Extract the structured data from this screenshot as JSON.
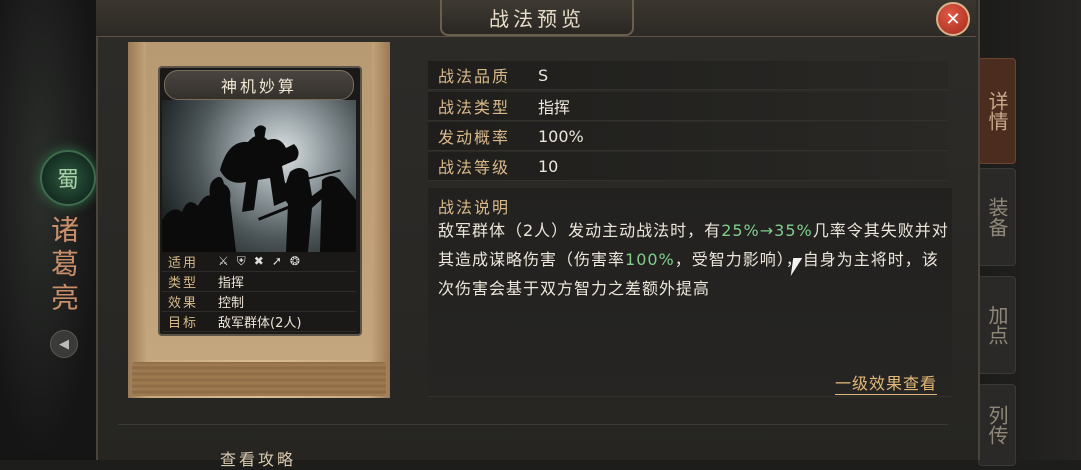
{
  "window": {
    "title": "战法预览",
    "close_label": "✕"
  },
  "hero": {
    "emblem_char": "蜀",
    "name": "诸葛亮"
  },
  "side_tabs": [
    {
      "label": "详情",
      "active": true
    },
    {
      "label": "装备",
      "active": false
    },
    {
      "label": "加点",
      "active": false
    },
    {
      "label": "列传",
      "active": false
    }
  ],
  "card": {
    "title": "神机妙算",
    "rows": [
      {
        "key": "适用",
        "icons": [
          "axe-icon",
          "shield-icon",
          "crossbow-icon",
          "spear-icon",
          "chariot-wheel-icon"
        ]
      },
      {
        "key": "类型",
        "value": "指挥"
      },
      {
        "key": "效果",
        "value": "控制"
      },
      {
        "key": "目标",
        "value": "敌军群体(2人)"
      }
    ]
  },
  "info": [
    {
      "key": "战法品质",
      "value": "S"
    },
    {
      "key": "战法类型",
      "value": "指挥"
    },
    {
      "key": "发动概率",
      "value": "100%"
    },
    {
      "key": "战法等级",
      "value": "10"
    }
  ],
  "description": {
    "title": "战法说明",
    "text_before": "敌军群体（2人）发动主动战法时，有",
    "highlight_1": "25%→35%",
    "text_mid": "几率令其失败并对其造成谋略伤害（伤害率",
    "highlight_2": "100%",
    "text_after": "，受智力影响），自身为主将时，该次伤害会基于双方智力之差额外提高"
  },
  "links": {
    "level_effect": "一级效果查看",
    "view_guide": "查看攻略"
  }
}
